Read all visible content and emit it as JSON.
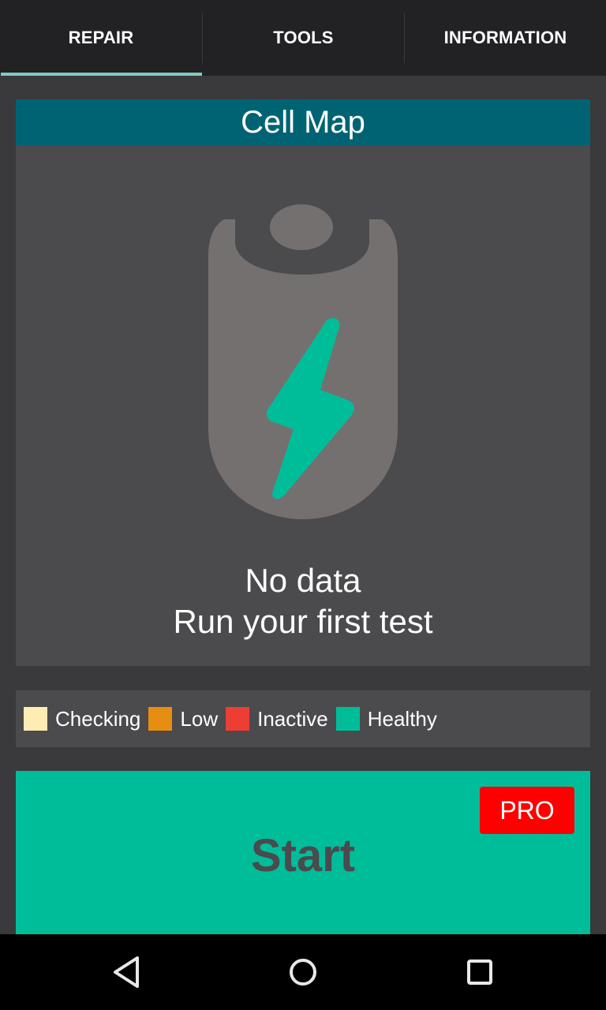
{
  "tabs": [
    {
      "label": "REPAIR",
      "selected": true
    },
    {
      "label": "TOOLS",
      "selected": false
    },
    {
      "label": "INFORMATION",
      "selected": false
    }
  ],
  "colors": {
    "accent": "#80cbc4",
    "header": "#006374",
    "healthy": "#00bd9a",
    "pro": "#ff0000"
  },
  "cell_map": {
    "title": "Cell Map",
    "icon": "battery-charging-icon",
    "message_line1": "No data",
    "message_line2": "Run your first test"
  },
  "legend": [
    {
      "label": "Checking",
      "color": "#ffecb3"
    },
    {
      "label": "Low",
      "color": "#e68e12"
    },
    {
      "label": "Inactive",
      "color": "#ee3e34"
    },
    {
      "label": "Healthy",
      "color": "#00bd9a"
    }
  ],
  "start_button": {
    "label": "Start",
    "badge": "PRO"
  },
  "navbar": {
    "back": "back-icon",
    "home": "home-icon",
    "recents": "recents-icon"
  }
}
